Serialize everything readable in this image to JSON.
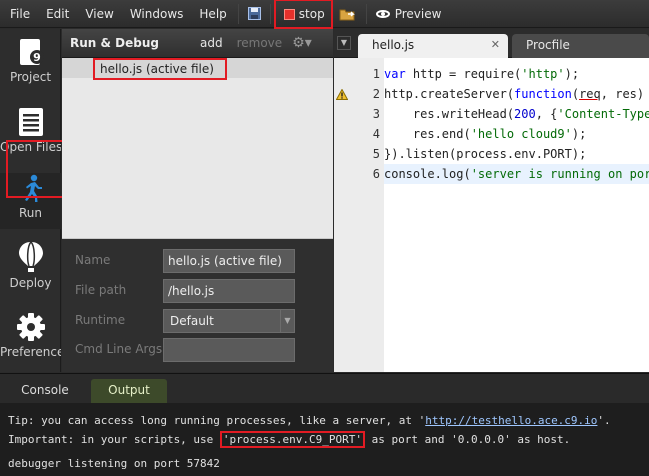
{
  "menubar": {
    "items": [
      "File",
      "Edit",
      "View",
      "Windows",
      "Help"
    ],
    "stop_label": "stop",
    "preview_label": "Preview"
  },
  "rail": {
    "items": [
      {
        "label": "Project",
        "icon": "project-icon"
      },
      {
        "label": "Open Files",
        "icon": "open-files-icon"
      },
      {
        "label": "Run",
        "icon": "run-icon"
      },
      {
        "label": "Deploy",
        "icon": "deploy-balloon-icon"
      },
      {
        "label": "Preferences",
        "icon": "gear-icon"
      }
    ]
  },
  "panel": {
    "title": "Run & Debug",
    "add_label": "add",
    "remove_label": "remove",
    "active_file": "hello.js (active file)",
    "props": {
      "name_label": "Name",
      "name_value": "hello.js (active file)",
      "path_label": "File path",
      "path_value": "/hello.js",
      "runtime_label": "Runtime",
      "runtime_value": "Default",
      "args_label": "Cmd Line Args",
      "args_value": ""
    }
  },
  "editor": {
    "tabs": [
      {
        "label": "hello.js",
        "active": true
      },
      {
        "label": "Procfile",
        "active": false
      }
    ],
    "line_numbers": [
      "1",
      "2",
      "3",
      "4",
      "5",
      "6"
    ]
  },
  "console": {
    "tabs": [
      "Console",
      "Output"
    ],
    "line1_text": "Tip: you can access long running processes, like a server, at '",
    "line1_link": "http://testhello.ace.c9.io",
    "line1_tail": "'.",
    "line2_pre": "Important: in your scripts, use ",
    "line2_box": "'process.env.C9_PORT'",
    "line2_post": " as port and '0.0.0.0' as host.",
    "line3": "debugger listening on port 57842"
  },
  "colors": {
    "highlight_red": "#e21b23",
    "output_tab": "#3d4a2a",
    "run_icon": "#2b8ad8"
  }
}
